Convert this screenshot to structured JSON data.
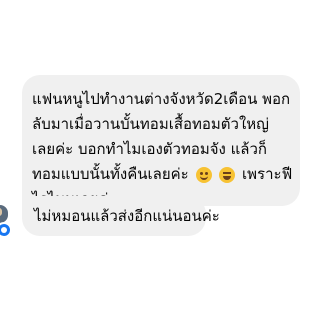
{
  "messages": [
    {
      "lines": [
        "แฟนหนูไปทำงานต่างจังหวัด2เดือน พอก",
        "ลับมาเมื่อวานบั้นทอมเสื้อทอมตัวใหญ่",
        "เลยค่ะ บอกทำไมเองตัวทอมจัง แล้วก็",
        "ทอมแบบนั้นทั้งคืนเลยค่ะ",
        "ไรไมนเลยค่ะ"
      ],
      "trailing_line_4_text": "เพราะฟี",
      "emojis": [
        "pleading-face-icon",
        "grinning-squinting-face-icon"
      ]
    },
    {
      "lines": [
        "ไม่หมอนแล้วส่งอีกแน่นอนค่ะ"
      ]
    }
  ],
  "colors": {
    "bubble": "#f0f0f0",
    "text": "#050505",
    "badge": "#1877f2"
  }
}
